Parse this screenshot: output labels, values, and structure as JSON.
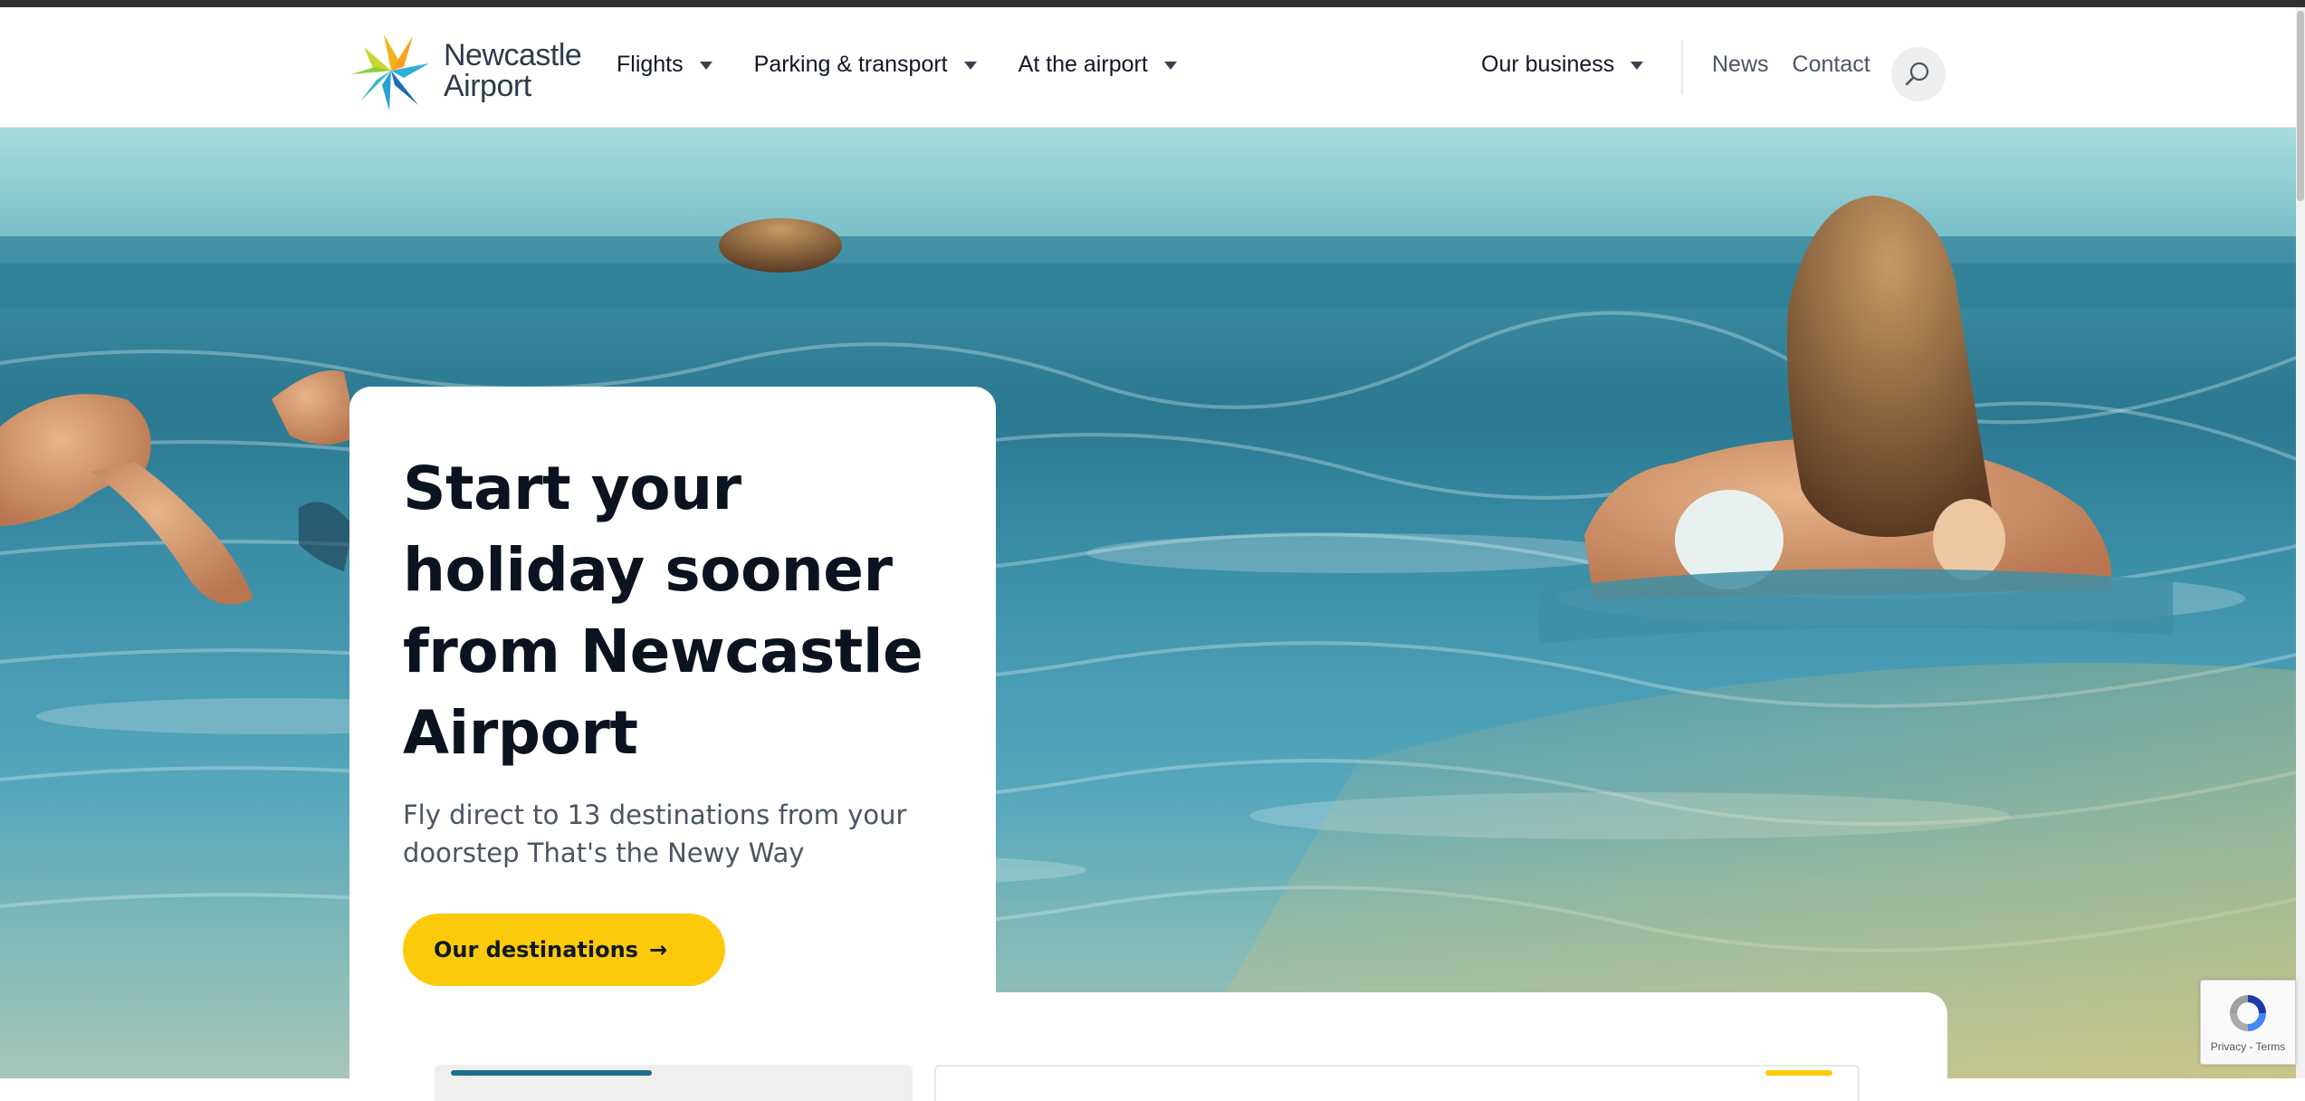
{
  "logo": {
    "line1": "Newcastle",
    "line2": "Airport"
  },
  "nav": {
    "flights": "Flights",
    "parking": "Parking & transport",
    "at_airport": "At the airport",
    "our_business": "Our business",
    "news": "News",
    "contact": "Contact"
  },
  "hero": {
    "title": "Start your holiday sooner from Newcastle Airport",
    "subtitle": "Fly direct to 13 destinations from your doorstep That's the Newy Way",
    "cta": "Our destinations",
    "cta_arrow": "→"
  },
  "recaptcha": {
    "links": "Privacy - Terms"
  },
  "icons": {
    "logo": "star-burst-logo-icon",
    "caret": "caret-down-icon",
    "search": "search-icon",
    "cta_arrow": "arrow-right-icon",
    "recaptcha": "recaptcha-icon"
  },
  "colors": {
    "accent_yellow": "#fdca0b",
    "header_bg": "#ffffff",
    "text_dark": "#0b1320",
    "text_muted": "#4b5563",
    "teal": "#1c6e8c"
  }
}
